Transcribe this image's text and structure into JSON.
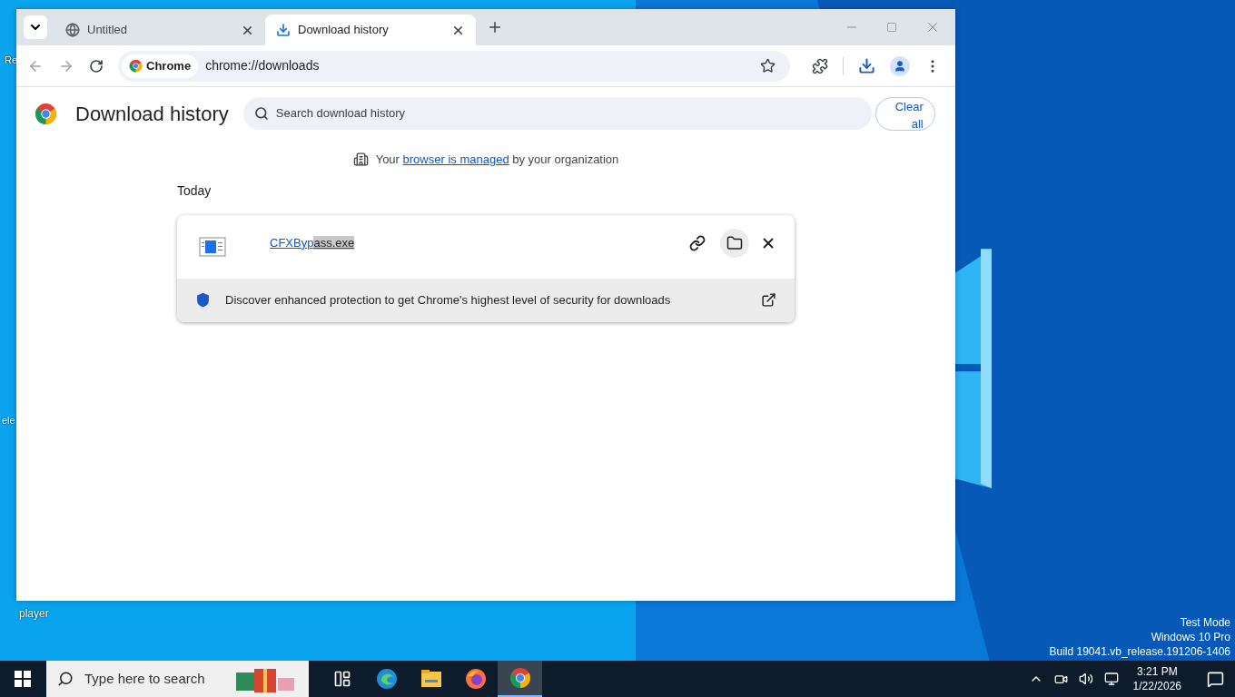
{
  "desktop": {
    "icon_labels": [
      "Re",
      "ele",
      "player"
    ],
    "system_notice": [
      "Test Mode",
      "Windows 10 Pro",
      "Build 19041.vb_release.191206-1406"
    ]
  },
  "browser": {
    "tabs": [
      {
        "title": "Untitled",
        "selected": false
      },
      {
        "title": "Download history",
        "selected": true
      }
    ],
    "address_bar": {
      "chip": "Chrome",
      "url": "chrome://downloads"
    }
  },
  "page": {
    "title": "Download history",
    "search": {
      "placeholder": "Search download history"
    },
    "clear_button": "Clear all",
    "managed_notice": {
      "before": "Your",
      "link": "browser is managed",
      "after": "by your organization"
    },
    "date_group": "Today",
    "downloads": [
      {
        "name_parts": [
          {
            "text": "CFXByp",
            "highlighted": false
          },
          {
            "text": "ass.exe",
            "highlighted": true
          }
        ],
        "promo": "Discover enhanced protection to get Chrome's highest level of security for downloads"
      }
    ]
  },
  "taskbar": {
    "search_placeholder": "Type here to search",
    "apps": [
      {
        "kind": "taskview",
        "selected": false
      },
      {
        "kind": "edge",
        "selected": false
      },
      {
        "kind": "explorer",
        "selected": false
      },
      {
        "kind": "firefox",
        "selected": false
      },
      {
        "kind": "chrome",
        "selected": true
      }
    ],
    "time": "3:21 PM",
    "date": "1/22/2026"
  }
}
